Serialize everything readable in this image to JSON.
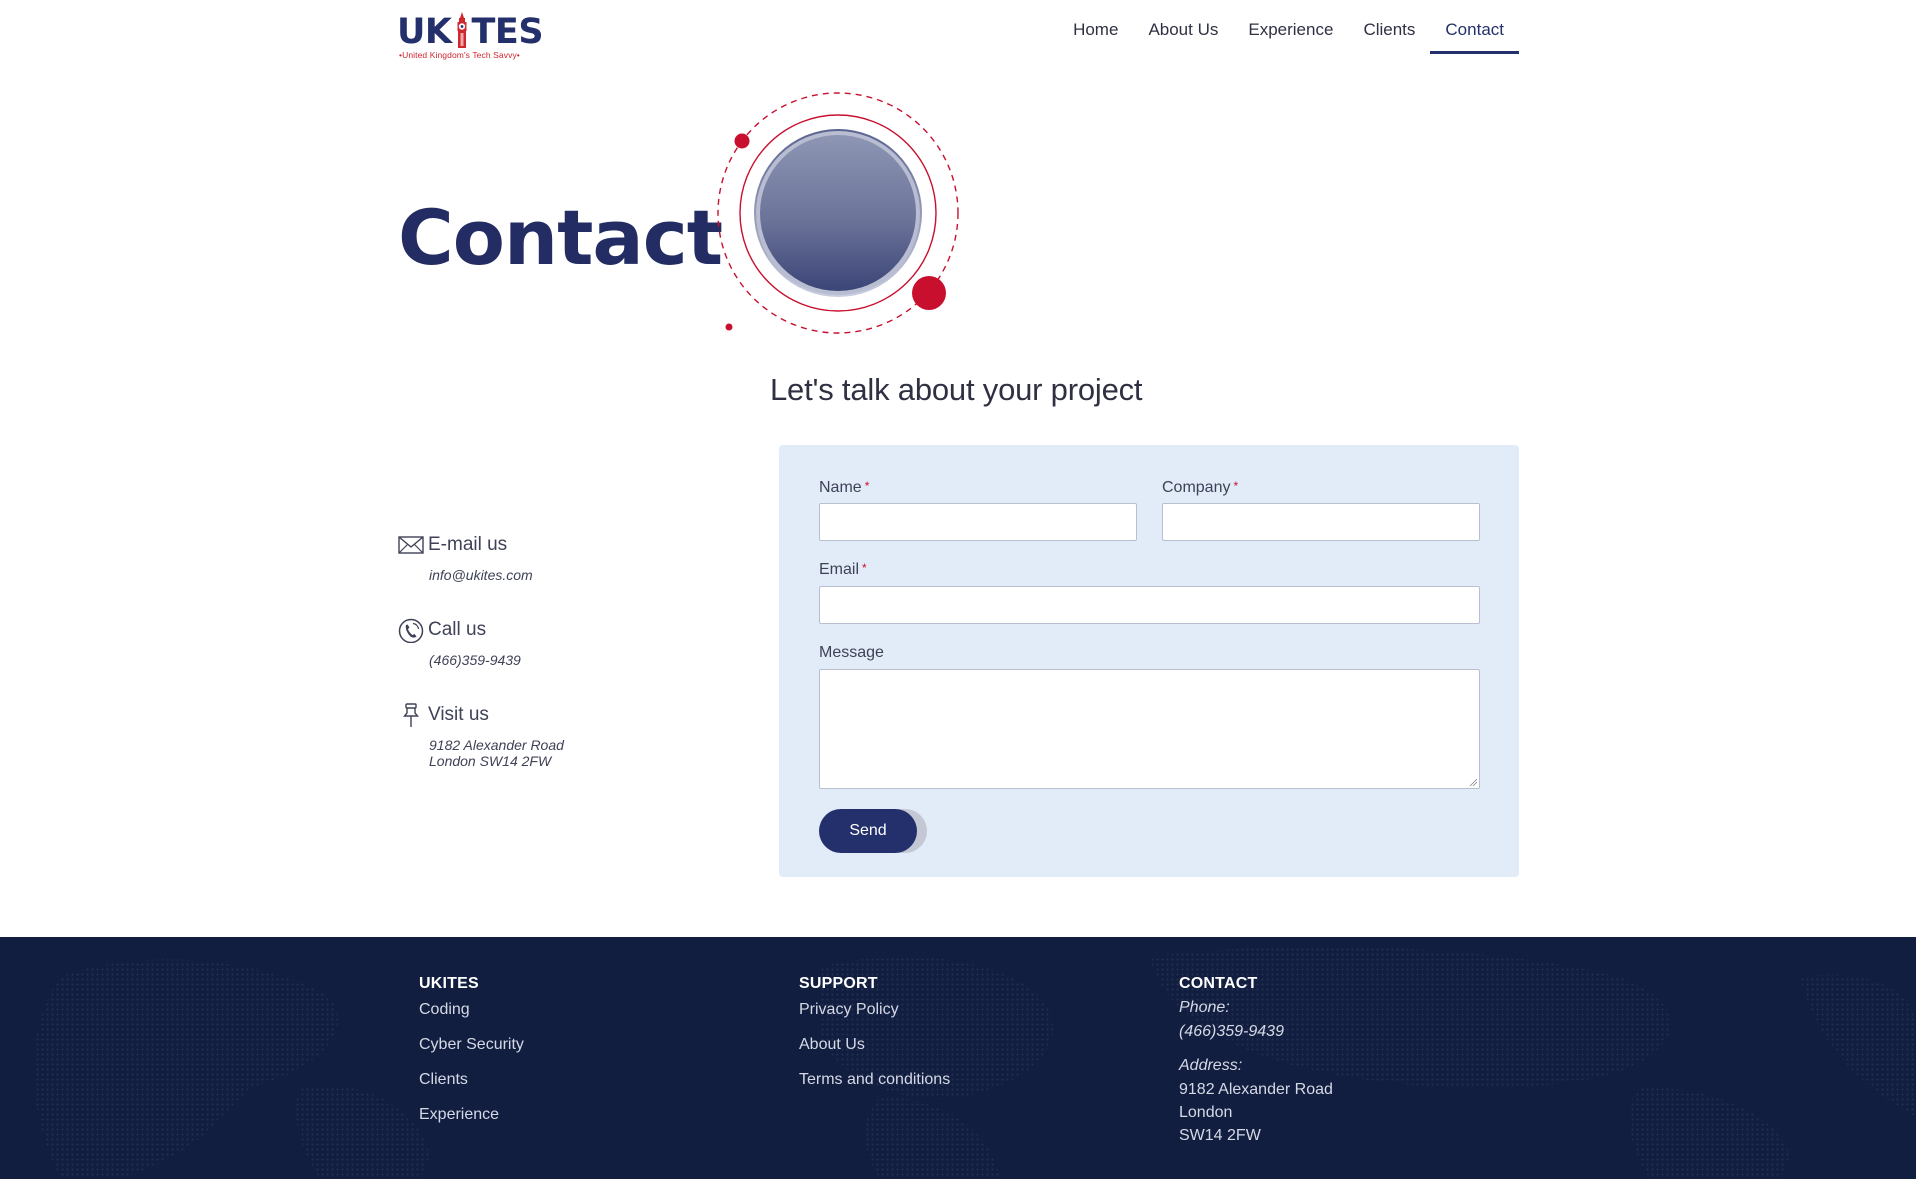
{
  "brand": {
    "name": "UKITES",
    "name_left": "UK",
    "name_right": "TES",
    "tagline": "•United Kingdom's Tech Savvy•"
  },
  "nav": {
    "items": [
      {
        "label": "Home"
      },
      {
        "label": "About Us"
      },
      {
        "label": "Experience"
      },
      {
        "label": "Clients"
      },
      {
        "label": "Contact",
        "active": true
      }
    ]
  },
  "hero": {
    "title": "Contact",
    "subtitle": "Let's talk about your project"
  },
  "contact_info": {
    "email": {
      "label": "E-mail us",
      "value": "info@ukites.com",
      "icon": "envelope-icon"
    },
    "phone": {
      "label": "Call us",
      "value": "(466)359-9439",
      "icon": "phone-icon"
    },
    "visit": {
      "label": "Visit us",
      "line1": "9182 Alexander Road",
      "line2": "London SW14 2FW",
      "icon": "pin-icon"
    }
  },
  "form": {
    "name_label": "Name",
    "company_label": "Company",
    "email_label": "Email",
    "message_label": "Message",
    "required_marker": "*",
    "name_value": "",
    "company_value": "",
    "email_value": "",
    "message_value": "",
    "send_label": "Send"
  },
  "footer": {
    "col1": {
      "heading": "UKITES",
      "links": [
        "Coding",
        "Cyber Security",
        "Clients",
        "Experience"
      ]
    },
    "col2": {
      "heading": "SUPPORT",
      "links": [
        "Privacy Policy",
        "About Us",
        "Terms and conditions"
      ]
    },
    "col3": {
      "heading": "CONTACT",
      "phone_label": "Phone:",
      "phone": "(466)359-9439",
      "address_label": "Address:",
      "address_line1": "9182 Alexander Road",
      "address_line2": "London",
      "address_line3": "SW14 2FW"
    }
  },
  "colors": {
    "brand_navy": "#23306b",
    "accent_red": "#c8102e",
    "form_bg": "#e2ecf8",
    "footer_bg": "#121e3f"
  }
}
